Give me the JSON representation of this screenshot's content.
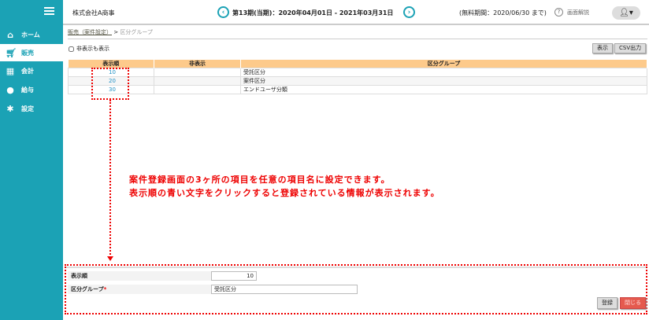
{
  "sidebar": {
    "items": [
      {
        "label": "ホーム",
        "icon": "home-icon"
      },
      {
        "label": "販売",
        "icon": "cart-icon",
        "active": true
      },
      {
        "label": "会計",
        "icon": "calculator-icon"
      },
      {
        "label": "給与",
        "icon": "money-bag-icon"
      },
      {
        "label": "設定",
        "icon": "gear-icon"
      }
    ]
  },
  "header": {
    "company": "株式会社A商事",
    "period": "第13期(当期)：2020年04月01日 - 2021年03月31日",
    "trial": "(無料期間：2020/06/30 まで)",
    "help": "画面解説"
  },
  "breadcrumb": {
    "parent": "販売（案件設定）",
    "sep": ">",
    "current": "区分グループ"
  },
  "filter": {
    "show_hidden": "非表示も表示"
  },
  "toolbar": {
    "display": "表示",
    "csv": "CSV出力"
  },
  "table": {
    "headers": [
      "表示順",
      "非表示",
      "区分グループ"
    ],
    "rows": [
      [
        "10",
        "",
        "受託区分"
      ],
      [
        "20",
        "",
        "案件区分"
      ],
      [
        "30",
        "",
        "エンドユーザ分類"
      ]
    ]
  },
  "annotation": {
    "line1": "案件登録画面の3ヶ所の項目を任意の項目名に設定できます。",
    "line2": "表示順の青い文字をクリックすると登録されている情報が表示されます。",
    "color": "#e00000"
  },
  "form": {
    "order_label": "表示順",
    "order_value": "10",
    "group_label": "区分グループ",
    "required": "*",
    "group_value": "受託区分",
    "register": "登録",
    "close": "閉じる"
  }
}
